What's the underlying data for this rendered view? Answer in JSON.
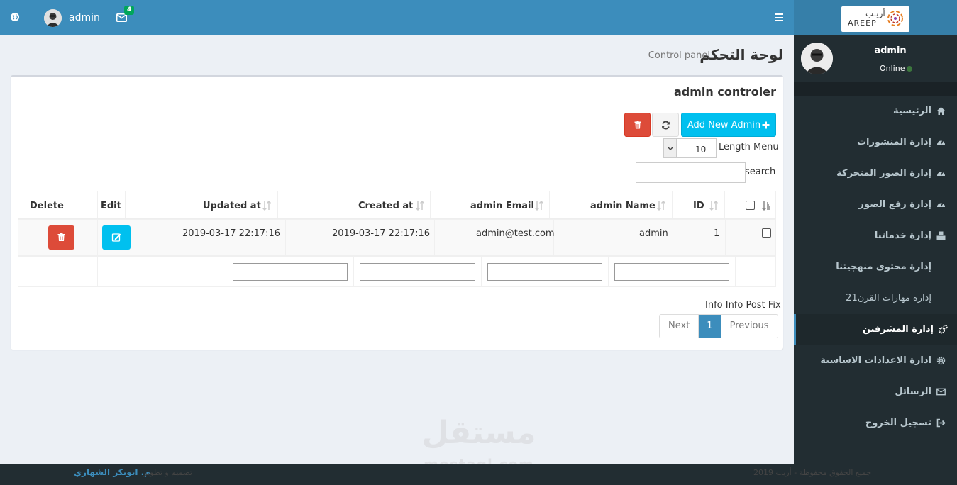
{
  "topbar": {
    "user_name": "admin",
    "mail_count": "4"
  },
  "logo": {
    "brand_latin": "AREEP",
    "brand_arabic": "أريـب"
  },
  "sidebar": {
    "user_name": "admin",
    "status": "Online",
    "items": [
      {
        "label": "الرئيسية",
        "icon": "home-icon"
      },
      {
        "label": "إدارة المنشورات",
        "icon": "dashboard-icon"
      },
      {
        "label": "إدارة الصور المتحركة",
        "icon": "dashboard-icon"
      },
      {
        "label": "إدارة رفع الصور",
        "icon": "dashboard-icon"
      },
      {
        "label": "إدارة خدماتنا",
        "icon": "cubes-icon"
      },
      {
        "label": "إدارة محتوى منهجيتنا",
        "icon": ""
      },
      {
        "label": "إدارة مهارات القرن21",
        "icon": ""
      },
      {
        "label": "إدارة المشرفين",
        "icon": "cogs-icon"
      },
      {
        "label": "ادارة الاعدادات الاساسية",
        "icon": "gear-icon"
      },
      {
        "label": "الرسائل",
        "icon": "envelope-icon"
      },
      {
        "label": "تسجيل الخروج",
        "icon": "sign-out-icon"
      }
    ]
  },
  "header": {
    "title": "لوحة التحكم",
    "subtitle": "Control panel"
  },
  "box": {
    "title": "admin controler",
    "add_button": "Add New Admin",
    "length_label": "Length Menu",
    "length_value": "10",
    "search_label": "search"
  },
  "table": {
    "columns": [
      "ID",
      "admin Name",
      "admin Email",
      "Created at",
      "Updated at",
      "Edit",
      "Delete"
    ],
    "rows": [
      {
        "id": "1",
        "name": "admin",
        "email": "admin@test.com",
        "created": "2019-03-17 22:17:16",
        "updated": "2019-03-17 22:17:16"
      }
    ]
  },
  "footer_table": {
    "info": "Info Info Post Fix",
    "next": "Next",
    "page": "1",
    "previous": "Previous"
  },
  "footer": {
    "designer_prefix": "تصميم و تطوير",
    "designer_name": "م. ابوبكر الشهاري",
    "copyright": "جميع الحقوق محفوظة - أريب 2019"
  },
  "watermark": {
    "arabic": "مستقل",
    "latin": "mostaql.com"
  },
  "colors": {
    "primary": "#3c8dbc",
    "sidebar": "#222d32",
    "info": "#00c0ef",
    "danger": "#dd4b39",
    "online": "#3c763d"
  }
}
